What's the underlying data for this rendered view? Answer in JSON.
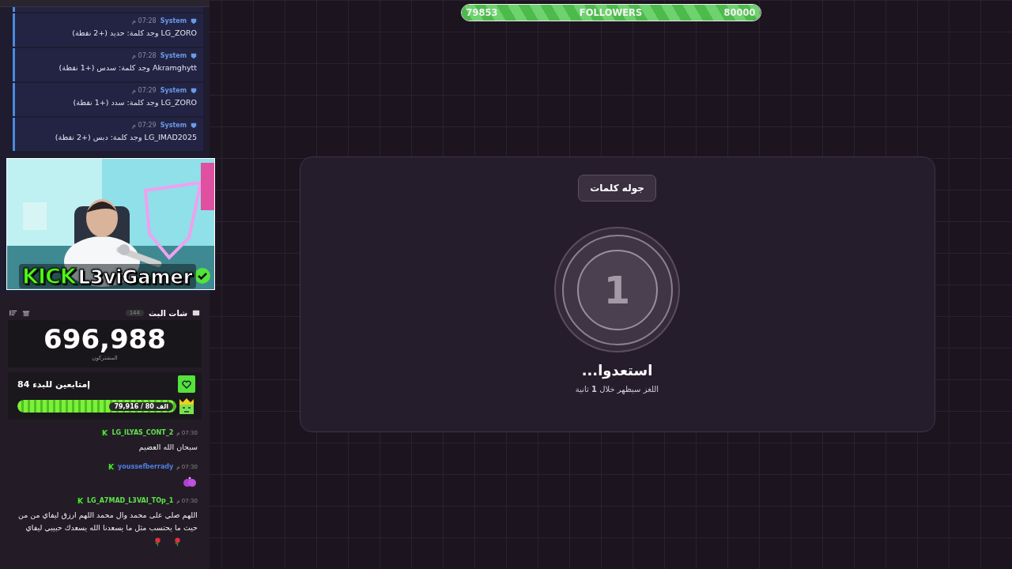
{
  "system_log": {
    "messages": [
      {
        "sender": "System",
        "time": "07:28 م",
        "text": "LG_ZORO وجد كلمة: حديد (+2 نقطة)"
      },
      {
        "sender": "System",
        "time": "07:28 م",
        "text": "Akramghytt وجد كلمة: سدس (+1 نقطة)"
      },
      {
        "sender": "System",
        "time": "07:29 م",
        "text": "LG_ZORO وجد كلمة: سدد (+1 نقطة)"
      },
      {
        "sender": "System",
        "time": "07:29 م",
        "text": "LG_IMAD2025 وجد كلمة: دبس (+2 نقطة)"
      }
    ]
  },
  "stream_overlay": {
    "kind": "picture",
    "platform": "KICK",
    "streamer": "L3viGamer",
    "verified": true
  },
  "chat": {
    "title": "شات البث",
    "count": "144",
    "subscribers": {
      "value": "696,988",
      "label": "المشتركون"
    },
    "goal": {
      "title": "إمتابعين للبدء 84",
      "progress_label": "الف 80 / 79,916",
      "level": 0.999
    },
    "messages": [
      {
        "kind": "text",
        "user": "LG_ILYAS_CONT_2",
        "color": "#5fe34a",
        "time": "07:30 م",
        "text": "سبحان الله العضيم"
      },
      {
        "kind": "sticker",
        "user": "youssefberrady",
        "color": "#4f7fe0",
        "time": "07:30 م"
      },
      {
        "kind": "text_roses",
        "user": "LG_A7MAD_L3VAI_TOp_1",
        "color": "#5fe34a",
        "time": "07:30 م",
        "text": "اللهم صلي على محمد وال محمد اللهم ارزق ليفاي من من حيث ما يحتسب مثل ما يسعدنا الله يسعدك حبيبي ليفاي"
      }
    ]
  },
  "followers_bar": {
    "current": "79853",
    "label": "FOLLOWERS",
    "target": "80000",
    "level": 0.998
  },
  "round": {
    "badge": "جوله كلمات",
    "countdown": "1",
    "title": "استعدوا...",
    "subtitle": "اللغز سيظهر خلال **1** ثانية"
  }
}
